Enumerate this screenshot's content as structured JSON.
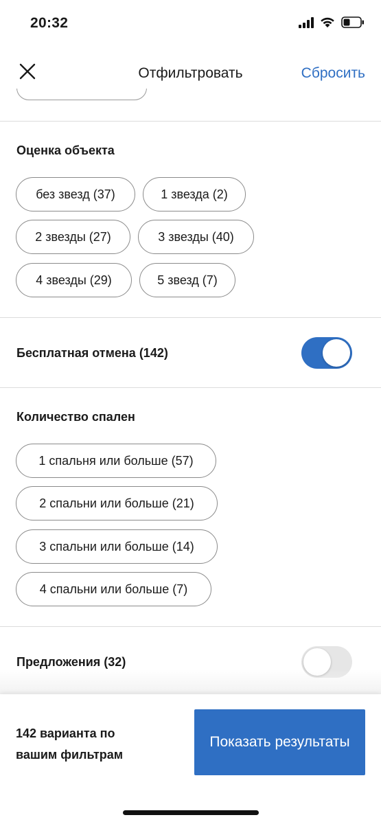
{
  "status_bar": {
    "time": "20:32"
  },
  "nav": {
    "title": "Отфильтровать",
    "reset_label": "Сбросить",
    "close_icon": "close-icon"
  },
  "rating": {
    "title": "Оценка объекта",
    "chips": [
      "без звезд (37)",
      "1 звезда (2)",
      "2 звезды (27)",
      "3 звезды (40)",
      "4 звезды (29)",
      "5 звезд (7)"
    ]
  },
  "free_cancel": {
    "label": "Бесплатная отмена (142)",
    "enabled": true
  },
  "bedrooms": {
    "title": "Количество спален",
    "chips": [
      "1 спальня или больше (57)",
      "2 спальни или больше (21)",
      "3 спальни или больше (14)",
      "4 спальни или больше (7)"
    ]
  },
  "offers": {
    "label": "Предложения (32)",
    "enabled": false
  },
  "footer": {
    "summary": "142 варианта по вашим фильтрам",
    "show_label": "Показать результаты"
  },
  "colors": {
    "accent": "#2f6fc3",
    "toggle_off": "#e6e6e6",
    "divider": "#dcdcdc"
  }
}
